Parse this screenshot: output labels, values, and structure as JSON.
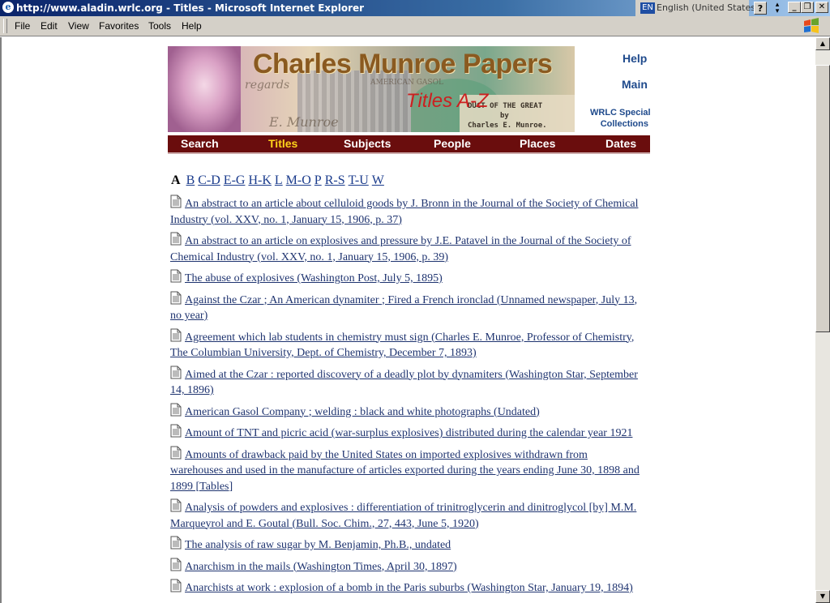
{
  "window": {
    "title": "http://www.aladin.wrlc.org - Titles - Microsoft Internet Explorer",
    "language_code": "EN",
    "language_label": "English (United States)",
    "help_glyph": "?",
    "minimize_glyph": "_",
    "restore_glyph": "❐",
    "close_glyph": "✕"
  },
  "menu": [
    "File",
    "Edit",
    "View",
    "Favorites",
    "Tools",
    "Help"
  ],
  "banner": {
    "title": "Charles Munroe Papers",
    "subtitle": "Titles A-Z",
    "doc_line1": "DUCT OF THE GREAT",
    "doc_line2": "by",
    "doc_line3": "Charles E. Munroe.",
    "script1": "regards",
    "script2": "AMERICAN GASOL",
    "script3": "E. Munroe"
  },
  "side_links": {
    "help": "Help",
    "main": "Main",
    "special_line1": "WRLC Special",
    "special_line2": "Collections"
  },
  "nav": [
    "Search",
    "Titles",
    "Subjects",
    "People",
    "Places",
    "Dates"
  ],
  "nav_active": "Titles",
  "alphabet": {
    "current": "A",
    "links": [
      "B",
      "C-D",
      "E-G",
      "H-K",
      "L",
      "M-O",
      "P",
      "R-S",
      "T-U",
      "W"
    ]
  },
  "entries": [
    "An abstract to an article about celluloid goods by J. Bronn in the Journal of the Society of Chemical Industry (vol. XXV, no. 1, January 15, 1906, p. 37)",
    "An abstract to an article on explosives and pressure by J.E. Patavel in the Journal of the Society of Chemical Industry (vol. XXV, no. 1, January 15, 1906, p. 39)",
    "The abuse of explosives (Washington Post, July 5, 1895)",
    "Against the Czar ; An American dynamiter ; Fired a French ironclad (Unnamed newspaper, July 13, no year)",
    "Agreement which lab students in chemistry must sign (Charles E. Munroe, Professor of Chemistry, The Columbian University, Dept. of Chemistry, December 7, 1893)",
    "Aimed at the Czar : reported discovery of a deadly plot by dynamiters (Washington Star, September 14, 1896)",
    "American Gasol Company ; welding : black and white photographs (Undated)",
    "Amount of TNT and picric acid (war-surplus explosives) distributed during the calendar year 1921",
    "Amounts of drawback paid by the United States on imported explosives withdrawn from warehouses and used in the manufacture of articles exported during the years ending June 30, 1898 and 1899 [Tables]",
    "Analysis of powders and explosives : differentiation of trinitroglycerin and dinitroglycol [by] M.M. Marqueyrol and E. Goutal (Bull. Soc. Chim., 27, 443, June 5, 1920)",
    "The analysis of raw sugar by M. Benjamin, Ph.B., undated",
    "Anarchism in the mails (Washington Times, April 30, 1897)",
    "Anarchists at work : explosion of a bomb in the Paris suburbs (Washington Star, January 19, 1894)"
  ],
  "colors": {
    "nav_bg": "#6a0d0d",
    "nav_active": "#ffd31a",
    "link": "#1f3470",
    "banner_title": "#8a5a20",
    "banner_subtitle": "#cc2020"
  }
}
